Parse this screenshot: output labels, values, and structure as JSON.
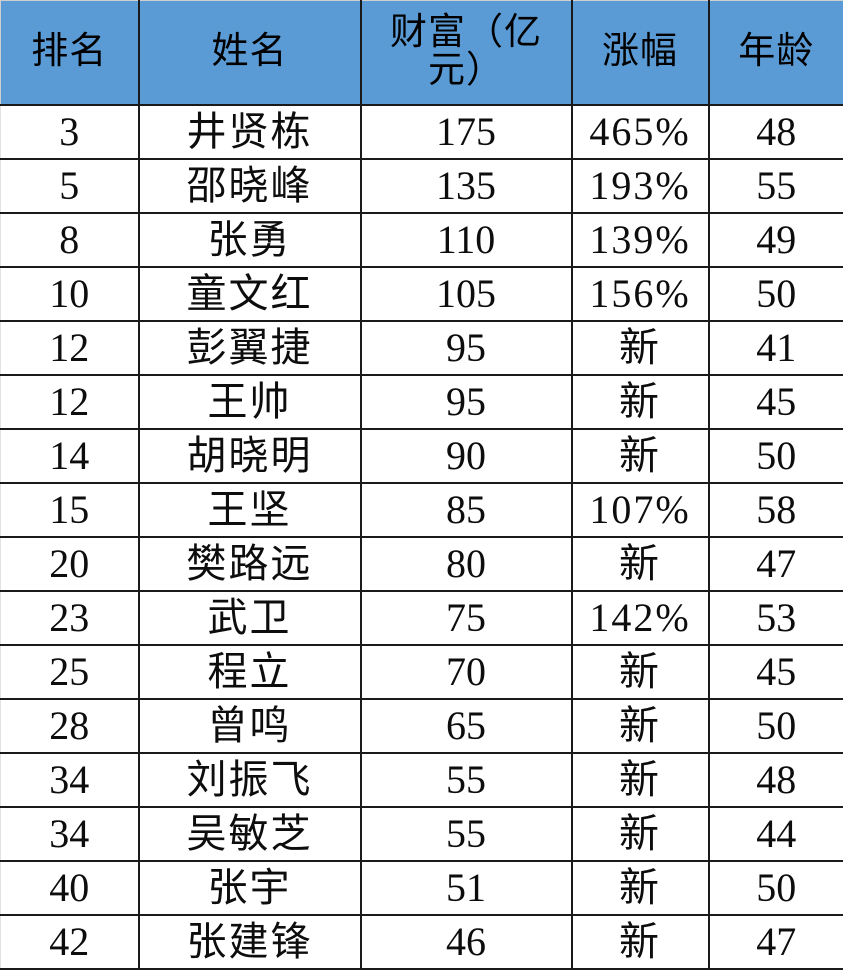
{
  "table": {
    "title": "",
    "header_bg": "#5B9BD5",
    "border_color": "#1a1a1a",
    "columns": [
      {
        "key": "rank",
        "label": "排名"
      },
      {
        "key": "name",
        "label": "姓名"
      },
      {
        "key": "worth",
        "label": "财富（亿元）"
      },
      {
        "key": "gain",
        "label": "涨幅"
      },
      {
        "key": "age",
        "label": "年龄"
      }
    ],
    "rows": [
      {
        "rank": "3",
        "name": "井贤栋",
        "worth": "175",
        "gain": "465%",
        "age": "48"
      },
      {
        "rank": "5",
        "name": "邵晓峰",
        "worth": "135",
        "gain": "193%",
        "age": "55"
      },
      {
        "rank": "8",
        "name": "张勇",
        "worth": "110",
        "gain": "139%",
        "age": "49"
      },
      {
        "rank": "10",
        "name": "童文红",
        "worth": "105",
        "gain": "156%",
        "age": "50"
      },
      {
        "rank": "12",
        "name": "彭翼捷",
        "worth": "95",
        "gain": "新",
        "age": "41"
      },
      {
        "rank": "12",
        "name": "王帅",
        "worth": "95",
        "gain": "新",
        "age": "45"
      },
      {
        "rank": "14",
        "name": "胡晓明",
        "worth": "90",
        "gain": "新",
        "age": "50"
      },
      {
        "rank": "15",
        "name": "王坚",
        "worth": "85",
        "gain": "107%",
        "age": "58"
      },
      {
        "rank": "20",
        "name": "樊路远",
        "worth": "80",
        "gain": "新",
        "age": "47"
      },
      {
        "rank": "23",
        "name": "武卫",
        "worth": "75",
        "gain": "142%",
        "age": "53"
      },
      {
        "rank": "25",
        "name": "程立",
        "worth": "70",
        "gain": "新",
        "age": "45"
      },
      {
        "rank": "28",
        "name": "曾鸣",
        "worth": "65",
        "gain": "新",
        "age": "50"
      },
      {
        "rank": "34",
        "name": "刘振飞",
        "worth": "55",
        "gain": "新",
        "age": "48"
      },
      {
        "rank": "34",
        "name": "吴敏芝",
        "worth": "55",
        "gain": "新",
        "age": "44"
      },
      {
        "rank": "40",
        "name": "张宇",
        "worth": "51",
        "gain": "新",
        "age": "50"
      },
      {
        "rank": "42",
        "name": "张建锋",
        "worth": "46",
        "gain": "新",
        "age": "47"
      }
    ]
  },
  "chart_data": {
    "type": "table",
    "title": "",
    "columns": [
      "排名",
      "姓名",
      "财富（亿元）",
      "涨幅",
      "年龄"
    ],
    "rows": [
      [
        "3",
        "井贤栋",
        175,
        "465%",
        48
      ],
      [
        "5",
        "邵晓峰",
        135,
        "193%",
        55
      ],
      [
        "8",
        "张勇",
        110,
        "139%",
        49
      ],
      [
        "10",
        "童文红",
        105,
        "156%",
        50
      ],
      [
        "12",
        "彭翼捷",
        95,
        "新",
        41
      ],
      [
        "12",
        "王帅",
        95,
        "新",
        45
      ],
      [
        "14",
        "胡晓明",
        90,
        "新",
        50
      ],
      [
        "15",
        "王坚",
        85,
        "107%",
        58
      ],
      [
        "20",
        "樊路远",
        80,
        "新",
        47
      ],
      [
        "23",
        "武卫",
        75,
        "142%",
        53
      ],
      [
        "25",
        "程立",
        70,
        "新",
        45
      ],
      [
        "28",
        "曾鸣",
        65,
        "新",
        50
      ],
      [
        "34",
        "刘振飞",
        55,
        "新",
        48
      ],
      [
        "34",
        "吴敏芝",
        55,
        "新",
        44
      ],
      [
        "40",
        "张宇",
        51,
        "新",
        50
      ],
      [
        "42",
        "张建锋",
        46,
        "新",
        47
      ]
    ]
  }
}
